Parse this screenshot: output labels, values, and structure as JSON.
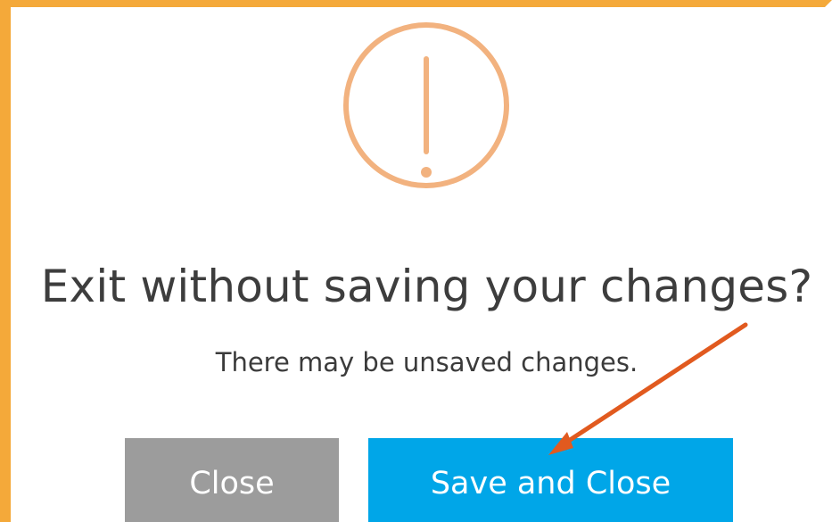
{
  "dialog": {
    "title": "Exit without saving your changes?",
    "message": "There may be unsaved changes.",
    "icon": "exclamation-circle-icon",
    "buttons": {
      "close_label": "Close",
      "save_close_label": "Save and Close"
    }
  },
  "colors": {
    "frame_border": "#f4a93a",
    "warning_icon": "#f2b27f",
    "close_button": "#9c9c9c",
    "save_button": "#00a6e8",
    "annotation_arrow": "#e15a1f"
  }
}
